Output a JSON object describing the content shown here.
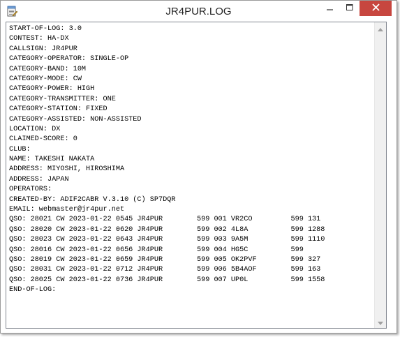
{
  "window": {
    "title": "JR4PUR.LOG"
  },
  "colors": {
    "close_button": "#c7463f",
    "titlebar": "#ffffff",
    "text": "#000000",
    "scrollbar_track": "#f0f0f0"
  },
  "icons": {
    "app": "notepad-icon",
    "minimize": "minimize-icon",
    "maximize": "maximize-icon",
    "close": "close-icon",
    "scroll_up": "chevron-up-icon",
    "scroll_down": "chevron-down-icon"
  },
  "document": {
    "lines": [
      "START-OF-LOG: 3.0",
      "CONTEST: HA-DX",
      "CALLSIGN: JR4PUR",
      "CATEGORY-OPERATOR: SINGLE-OP",
      "CATEGORY-BAND: 10M",
      "CATEGORY-MODE: CW",
      "CATEGORY-POWER: HIGH",
      "CATEGORY-TRANSMITTER: ONE",
      "CATEGORY-STATION: FIXED",
      "CATEGORY-ASSISTED: NON-ASSISTED",
      "LOCATION: DX",
      "CLAIMED-SCORE: 0",
      "CLUB:",
      "NAME: TAKESHI NAKATA",
      "ADDRESS: MIYOSHI, HIROSHIMA",
      "ADDRESS: JAPAN",
      "OPERATORS:",
      "CREATED-BY: ADIF2CABR V.3.10 (C) SP7DQR",
      "EMAIL: webmaster@jr4pur.net",
      "QSO: 28021 CW 2023-01-22 0545 JR4PUR        599 001 VR2CO         599 131",
      "QSO: 28020 CW 2023-01-22 0620 JR4PUR        599 002 4L8A          599 1288",
      "QSO: 28023 CW 2023-01-22 0643 JR4PUR        599 003 9A5M          599 1110",
      "QSO: 28016 CW 2023-01-22 0656 JR4PUR        599 004 HG5C          599",
      "QSO: 28019 CW 2023-01-22 0659 JR4PUR        599 005 OK2PVF        599 327",
      "QSO: 28031 CW 2023-01-22 0712 JR4PUR        599 006 5B4AOF        599 163",
      "QSO: 28025 CW 2023-01-22 0736 JR4PUR        599 007 UP0L          599 1558",
      "END-OF-LOG:"
    ]
  }
}
